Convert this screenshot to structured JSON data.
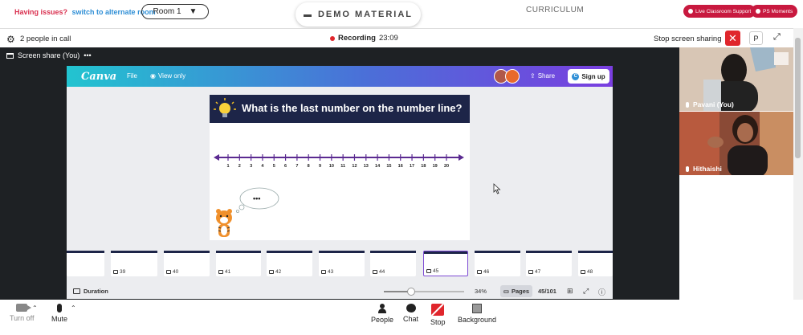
{
  "top": {
    "issues_text": "Having issues?",
    "alt_room_link": "switch to alternate room",
    "room_select": "Room 1",
    "demo_material_tab": "DEMO MATERIAL",
    "curriculum_label": "CURRICULUM",
    "live_support_btn": "Live Classroom Support",
    "ps_moments_btn": "PS Moments"
  },
  "call": {
    "people_count": "2 people in call",
    "recording_label": "Recording",
    "recording_time": "23:09",
    "stop_share_label": "Stop screen sharing",
    "p_btn": "P"
  },
  "screen_share_label": "Screen share (You)",
  "canva": {
    "logo": "Canva",
    "file_menu": "File",
    "view_only": "View only",
    "share_btn": "Share",
    "signup_btn": "Sign up",
    "slide_title": "What is the last number on the number line?",
    "number_line": [
      "1",
      "2",
      "3",
      "4",
      "5",
      "6",
      "7",
      "8",
      "9",
      "10",
      "11",
      "12",
      "13",
      "14",
      "15",
      "16",
      "17",
      "18",
      "19",
      "20"
    ],
    "thought_text": "•••",
    "thumbnails": [
      {
        "label": "",
        "active": false
      },
      {
        "label": "39",
        "active": false
      },
      {
        "label": "40",
        "active": false
      },
      {
        "label": "41",
        "active": false
      },
      {
        "label": "42",
        "active": false
      },
      {
        "label": "43",
        "active": false
      },
      {
        "label": "44",
        "active": false
      },
      {
        "label": "45",
        "active": true
      },
      {
        "label": "46",
        "active": false
      },
      {
        "label": "47",
        "active": false
      },
      {
        "label": "48",
        "active": false
      }
    ],
    "duration_label": "Duration",
    "zoom_level": 0.34,
    "zoom_text": "34%",
    "pages_btn": "Pages",
    "page_count": "45/101"
  },
  "participants": [
    {
      "name": "Pavani (You)"
    },
    {
      "name": "Hithaishi"
    }
  ],
  "controls": {
    "camera_label": "Turn off",
    "mute_label": "Mute",
    "people_label": "People",
    "chat_label": "Chat",
    "stop_label": "Stop",
    "background_label": "Background"
  },
  "colors": {
    "brand_red": "#c8193f",
    "recording_red": "#e0262c",
    "slide_header": "#1d2548",
    "number_line": "#5b2a91",
    "active_thumb": "#7d4ad4"
  }
}
